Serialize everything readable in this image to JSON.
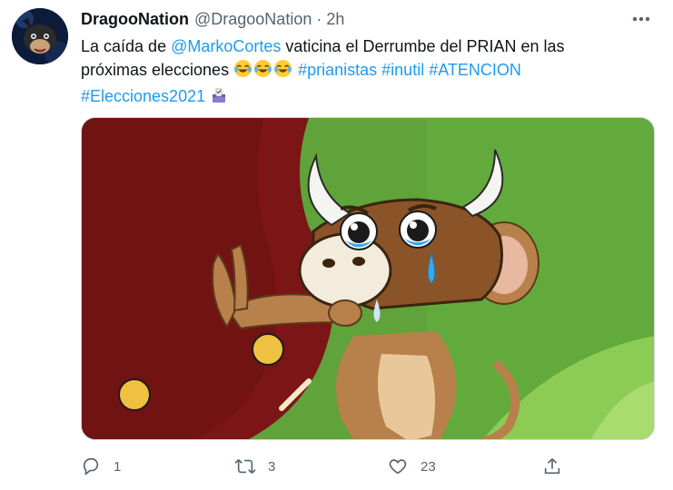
{
  "author": {
    "display_name": "DragooNation",
    "handle": "@DragooNation",
    "separator": "·",
    "time": "2h"
  },
  "tweet": {
    "text_intro": "La caída de ",
    "mention": "@MarkoCortes",
    "text_mid": " vaticina el Derrumbe del PRIAN en las próximas elecciones ",
    "hashtags": [
      "#prianistas",
      "#inutil",
      "#ATENCION",
      "#Elecciones2021"
    ]
  },
  "media": {
    "icon": "crying-bull-cartoon-image"
  },
  "actions": {
    "replies": "1",
    "retweets": "3",
    "likes": "23"
  },
  "colors": {
    "link": "#1d9bf0",
    "secondary": "#536471"
  }
}
